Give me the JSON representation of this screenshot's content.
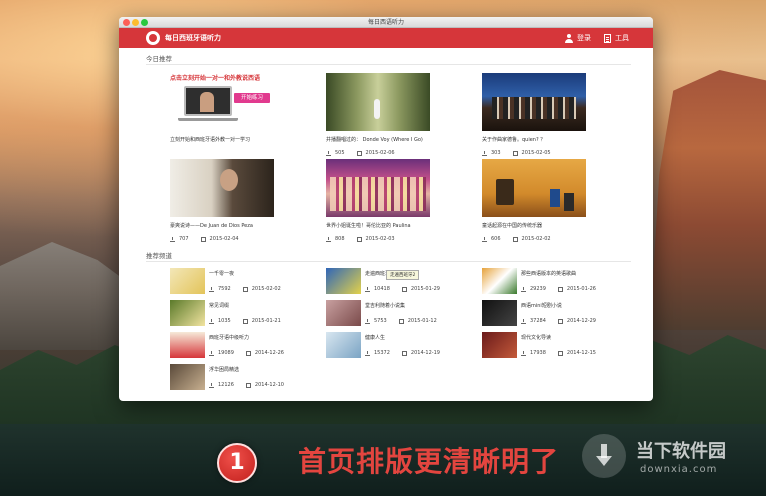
{
  "window": {
    "title": "每日西语听力"
  },
  "appbar": {
    "app_name": "每日西班牙语听力",
    "login_label": "登录",
    "tools_label": "工具"
  },
  "today": {
    "section_title": "今日推荐",
    "promo": {
      "headline": "点击立刻开始一对一和外教说西语",
      "button": "开始练习"
    },
    "cards": [
      {
        "title": "立刻开始和西班牙语外教一对一学习",
        "downloads": "",
        "date": ""
      },
      {
        "title": "并播翻唱过的： Donde Voy (Where I Go)",
        "downloads": "505",
        "date": "2015-02-06"
      },
      {
        "title": "关于作曲家德鲁。quien? ？",
        "downloads": "303",
        "date": "2015-02-05"
      },
      {
        "title": "豪爽说诗——De Juan de Dios Peza",
        "downloads": "707",
        "date": "2015-02-04"
      },
      {
        "title": "世界小姐诞生啦！哥伦比亚的 Paulina",
        "downloads": "808",
        "date": "2015-02-03"
      },
      {
        "title": "童话起源在中国的传统乐器",
        "downloads": "606",
        "date": "2015-02-02"
      }
    ]
  },
  "recommended": {
    "section_title": "推荐频道",
    "items": [
      {
        "title": "一千零一夜",
        "downloads": "7592",
        "date": "2015-02-02"
      },
      {
        "title": "走遍西班牙2",
        "downloads": "10418",
        "date": "2015-01-29"
      },
      {
        "title": "那些西语版本的英语歌曲",
        "downloads": "29239",
        "date": "2015-01-26"
      },
      {
        "title": "常见词缀",
        "downloads": "1035",
        "date": "2015-01-21"
      },
      {
        "title": "堂吉利随着小说集",
        "downloads": "5753",
        "date": "2015-01-12"
      },
      {
        "title": "西语mini短剧小说",
        "downloads": "37284",
        "date": "2014-12-29"
      },
      {
        "title": "西班牙语中级听力",
        "downloads": "19089",
        "date": "2014-12-26"
      },
      {
        "title": "健康人生",
        "downloads": "15372",
        "date": "2014-12-19"
      },
      {
        "title": "现代文化导读",
        "downloads": "17938",
        "date": "2014-12-15"
      },
      {
        "title": "浮华困局精选",
        "downloads": "12126",
        "date": "2014-12-10"
      }
    ],
    "tooltip": "走遍西班牙2"
  },
  "banner": {
    "badge": "1",
    "text": "首页排版更清晰明了"
  },
  "watermark": {
    "name": "当下软件园",
    "url": "downxia.com"
  },
  "colors": {
    "accent": "#d6363a",
    "promo_button": "#e13a8e",
    "badge": "#d8302b"
  }
}
